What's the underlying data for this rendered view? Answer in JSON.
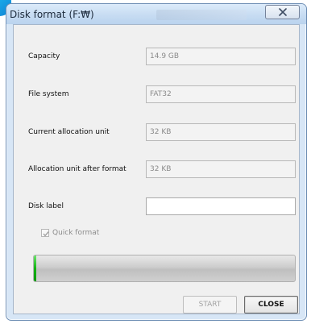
{
  "window": {
    "title": "Disk format (F:₩)"
  },
  "form": {
    "capacity": {
      "label": "Capacity",
      "value": "14.9 GB"
    },
    "file_system": {
      "label": "File system",
      "value": "FAT32"
    },
    "current_allocation_unit": {
      "label": "Current allocation unit",
      "value": "32 KB"
    },
    "allocation_unit_after_format": {
      "label": "Allocation unit after format",
      "value": "32 KB"
    },
    "disk_label": {
      "label": "Disk label",
      "value": ""
    },
    "quick_format": {
      "label": "Quick format",
      "checked": true
    }
  },
  "progress": {
    "fraction": 0.01
  },
  "buttons": {
    "start": "START",
    "close": "CLOSE"
  },
  "colors": {
    "progress_fill": "#12b312",
    "accent": "#1d92e1"
  },
  "icons": {
    "close": "close-icon",
    "checkmark": "checkmark-icon"
  }
}
